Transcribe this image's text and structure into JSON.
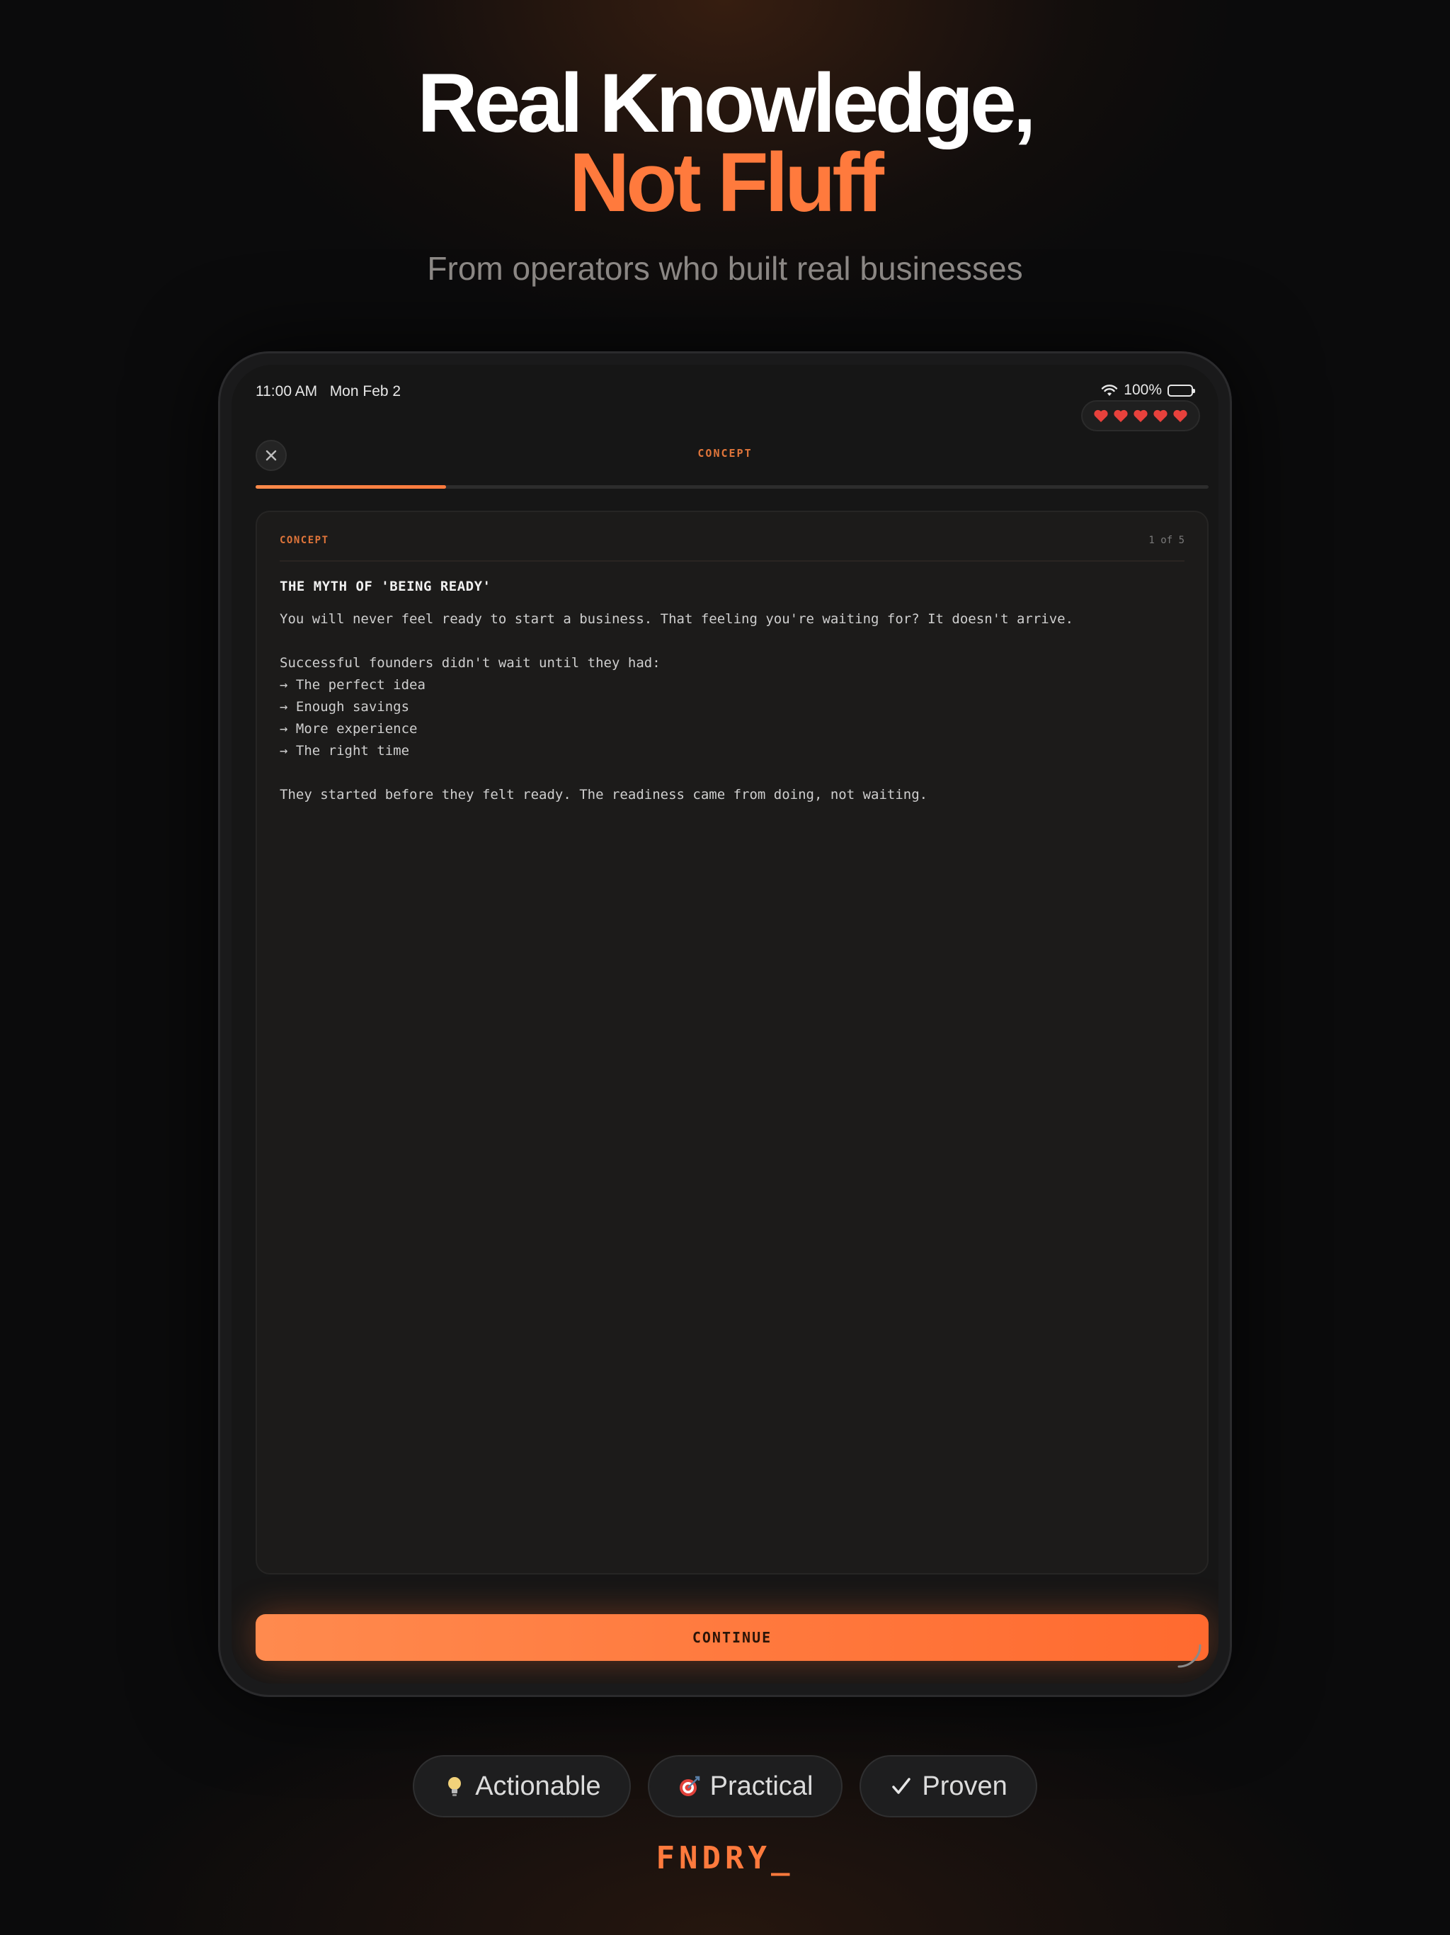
{
  "hero": {
    "title_line1": "Real Knowledge,",
    "title_line2": "Not Fluff",
    "subtitle": "From operators who built real businesses"
  },
  "statusbar": {
    "time": "11:00 AM",
    "date": "Mon Feb 2",
    "battery": "100%"
  },
  "lesson": {
    "hearts": 5,
    "screen_title": "CONCEPT",
    "progress": 0.2,
    "close_icon": "close-icon"
  },
  "card": {
    "tag": "CONCEPT",
    "page": "1 of 5",
    "heading": "THE MYTH OF 'BEING READY'",
    "lines": [
      "You will never feel ready to start a business. That feeling you're waiting for? It doesn't arrive.",
      "",
      "Successful founders didn't wait until they had:",
      "→ The perfect idea",
      "→ Enough savings",
      "→ More experience",
      "→ The right time",
      "",
      "They started before they felt ready. The readiness came from doing, not waiting."
    ]
  },
  "continue_label": "CONTINUE",
  "badges": [
    {
      "icon": "lightbulb-icon",
      "label": "Actionable"
    },
    {
      "icon": "target-icon",
      "label": "Practical"
    },
    {
      "icon": "checkmark-icon",
      "label": "Proven"
    }
  ],
  "brand": "FNDRY_",
  "colors": {
    "accent": "#ff7a3d",
    "heart": "#e8413c"
  }
}
